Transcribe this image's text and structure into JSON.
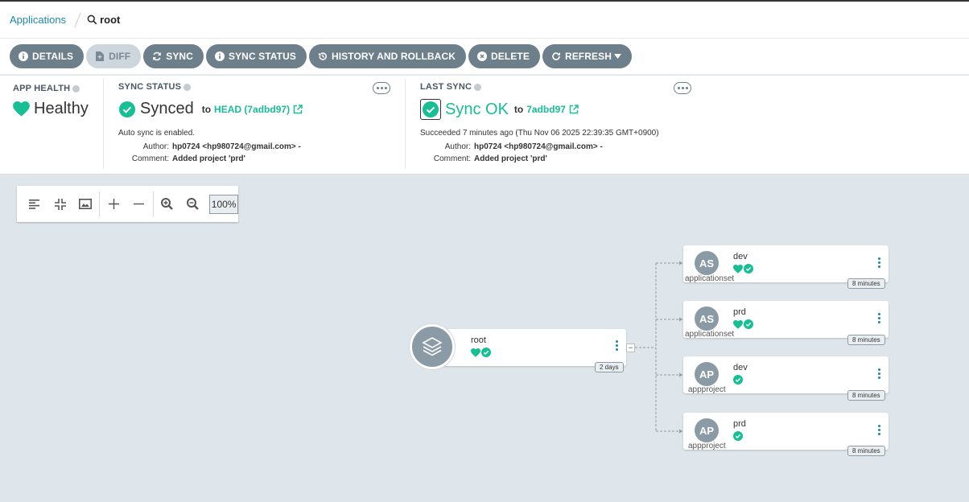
{
  "breadcrumb": {
    "parent": "Applications",
    "current": "root"
  },
  "toolbar": {
    "details": "DETAILS",
    "diff": "DIFF",
    "sync": "SYNC",
    "sync_status": "SYNC STATUS",
    "history": "HISTORY AND ROLLBACK",
    "delete": "DELETE",
    "refresh": "REFRESH"
  },
  "app_health": {
    "title": "APP HEALTH",
    "value": "Healthy"
  },
  "sync_status": {
    "title": "SYNC STATUS",
    "value": "Synced",
    "to_label": "to",
    "revision": "HEAD (7adbd97)",
    "auto_sync": "Auto sync is enabled.",
    "author_label": "Author:",
    "author": "hp0724 <hp980724@gmail.com> -",
    "comment_label": "Comment:",
    "comment": "Added project 'prd'"
  },
  "last_sync": {
    "title": "LAST SYNC",
    "value": "Sync OK",
    "to_label": "to",
    "revision": "7adbd97",
    "succeeded": "Succeeded 7 minutes ago (Thu Nov 06 2025 22:39:35 GMT+0900)",
    "author_label": "Author:",
    "author": "hp0724 <hp980724@gmail.com> -",
    "comment_label": "Comment:",
    "comment": "Added project 'prd'"
  },
  "graph": {
    "zoom": "100%",
    "root": {
      "name": "root",
      "age": "2 days"
    },
    "children": [
      {
        "abbr": "AS",
        "name": "dev",
        "kind": "applicationset",
        "age": "8 minutes"
      },
      {
        "abbr": "AS",
        "name": "prd",
        "kind": "applicationset",
        "age": "8 minutes"
      },
      {
        "abbr": "AP",
        "name": "dev",
        "kind": "appproject",
        "age": "8 minutes"
      },
      {
        "abbr": "AP",
        "name": "prd",
        "kind": "appproject",
        "age": "8 minutes"
      }
    ]
  },
  "colors": {
    "accent": "#18be94",
    "link": "#1d88a6",
    "button": "#6d7f8b",
    "canvas": "#dee6eb"
  },
  "icons": [
    "search-icon",
    "info-icon",
    "file-icon",
    "sync-icon",
    "history-icon",
    "close-circle-icon",
    "refresh-icon",
    "caret-down-icon",
    "heart-icon",
    "check-circle-icon",
    "external-link-icon",
    "layers-icon"
  ]
}
